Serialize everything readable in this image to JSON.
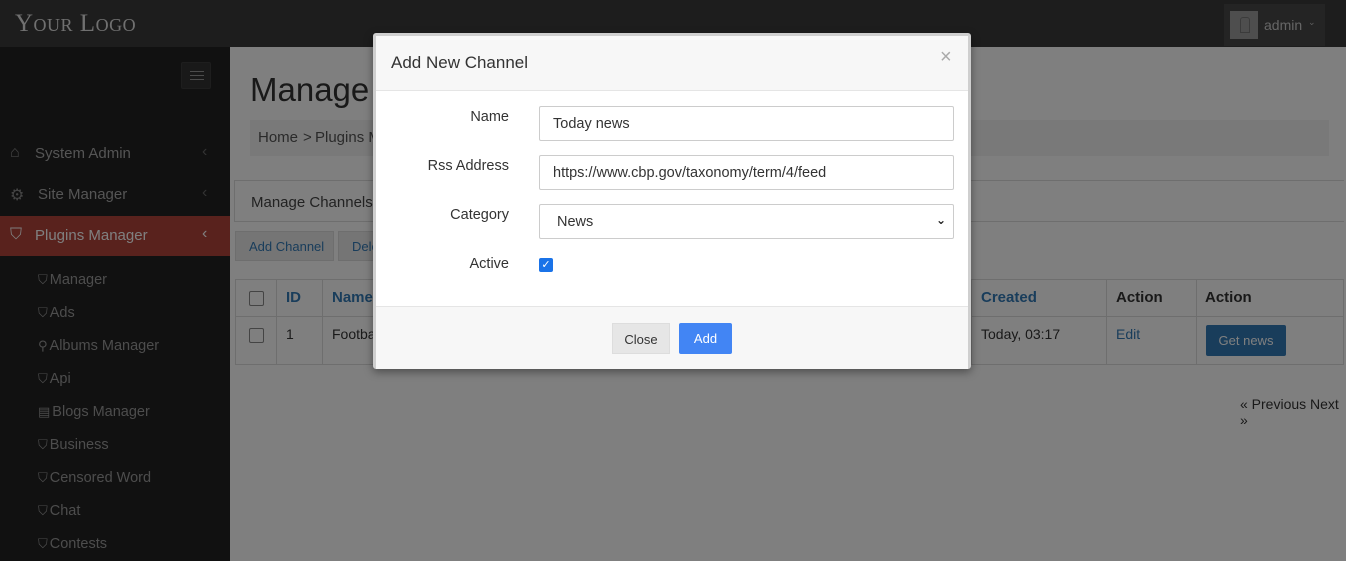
{
  "topbar": {
    "logo": "Your Logo",
    "user_name": "admin",
    "caret": "⌄"
  },
  "sidebar": {
    "menu": [
      {
        "label": "System Admin",
        "icon": "home-icon",
        "arrow": "‹"
      },
      {
        "label": "Site Manager",
        "icon": "gears-icon",
        "arrow": "‹"
      },
      {
        "label": "Plugins Manager",
        "icon": "tags-icon",
        "arrow": "‹"
      }
    ],
    "submenu": [
      {
        "label": "Manager",
        "icon": "tag-icon"
      },
      {
        "label": "Ads",
        "icon": "tag-icon"
      },
      {
        "label": "Albums Manager",
        "icon": "plug-icon"
      },
      {
        "label": "Api",
        "icon": "tag-icon"
      },
      {
        "label": "Blogs Manager",
        "icon": "comment-icon"
      },
      {
        "label": "Business",
        "icon": "tag-icon"
      },
      {
        "label": "Censored Word",
        "icon": "tag-icon"
      },
      {
        "label": "Chat",
        "icon": "tag-icon"
      },
      {
        "label": "Contests",
        "icon": "tag-icon"
      }
    ]
  },
  "main": {
    "title": "Manage C",
    "breadcrumb": {
      "home": "Home",
      "sep": ">",
      "item": "Plugins M"
    },
    "panel_title": "Manage Channels",
    "add_channel_label": "Add Channel",
    "delete_label": "Dele",
    "table": {
      "headers": {
        "id": "ID",
        "name": "Name",
        "created": "Created",
        "action1": "Action",
        "action2": "Action"
      },
      "rows": [
        {
          "id": "1",
          "name": "Footba",
          "created": "Today, 03:17",
          "edit": "Edit",
          "get_news": "Get news"
        }
      ]
    },
    "pager": "« Previous Next »"
  },
  "modal": {
    "title": "Add New Channel",
    "close_icon": "×",
    "fields": {
      "name_label": "Name",
      "name_value": "Today news",
      "rss_label": "Rss Address",
      "rss_value": "https://www.cbp.gov/taxonomy/term/4/feed",
      "category_label": "Category",
      "category_value": "News",
      "active_label": "Active",
      "active_checked": true
    },
    "close_button": "Close",
    "add_button": "Add"
  },
  "colors": {
    "navbar": "#3a3a3a",
    "sidebar": "#222222",
    "active_menu": "#b3443a",
    "primary": "#337ab7",
    "modal_add": "#4285f4"
  }
}
